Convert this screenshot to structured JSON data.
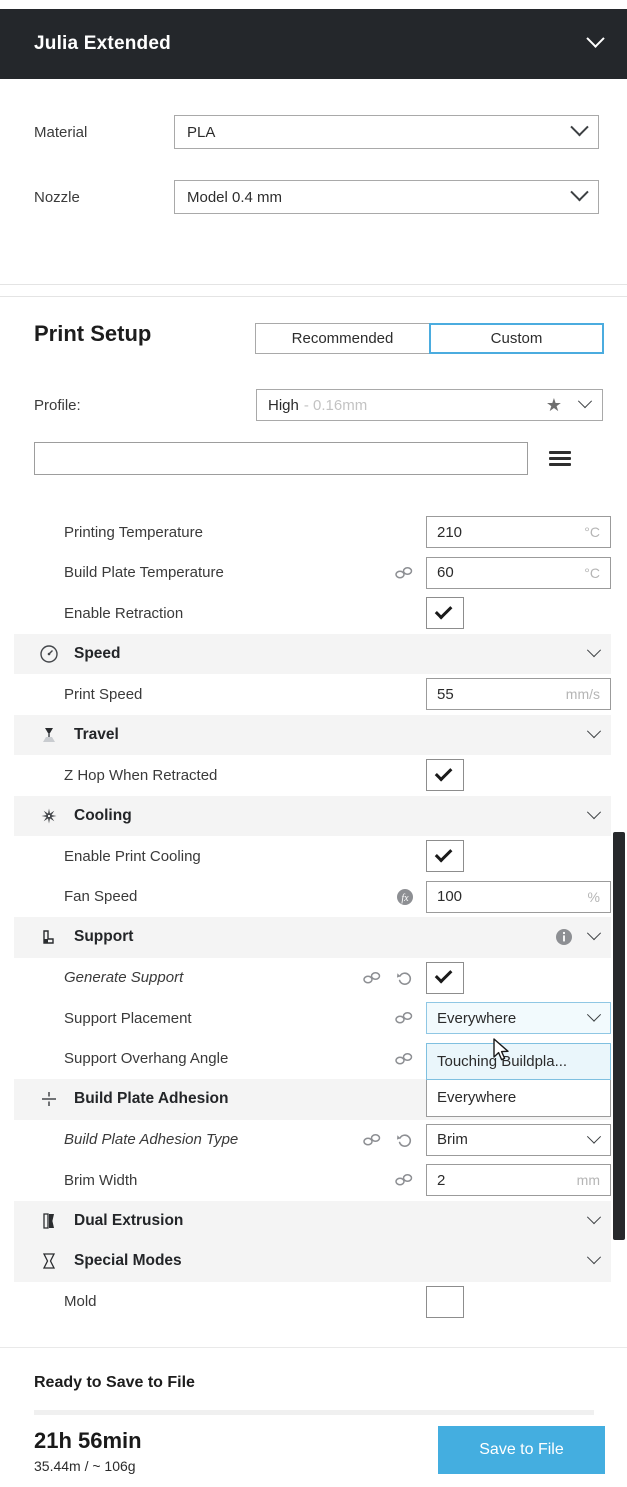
{
  "titlebar": {
    "title": "Julia Extended",
    "chevron_icon": "chevron-down-icon"
  },
  "machine": {
    "rows": [
      {
        "label": "Material",
        "value": "PLA"
      },
      {
        "label": "Nozzle",
        "value": "Model 0.4 mm"
      }
    ]
  },
  "print_setup": {
    "title": "Print Setup",
    "tabs": [
      {
        "label": "Recommended",
        "active": false
      },
      {
        "label": "Custom",
        "active": true
      }
    ],
    "profile": {
      "label": "Profile:",
      "value_main": "High",
      "value_sub": "- 0.16mm",
      "star_icon": "star-icon",
      "chevron_icon": "chevron-down-icon"
    },
    "search": {
      "value": "",
      "placeholder": ""
    },
    "menu_icon": "hamburger-menu-icon"
  },
  "settings": [
    {
      "type": "setting",
      "label": "Printing Temperature",
      "control": "number",
      "value": "210",
      "unit": "°C",
      "icons": []
    },
    {
      "type": "setting",
      "label": "Build Plate Temperature",
      "control": "number",
      "value": "60",
      "unit": "°C",
      "icons": [
        "link-icon"
      ]
    },
    {
      "type": "setting",
      "label": "Enable Retraction",
      "control": "checkbox",
      "checked": true,
      "icons": []
    },
    {
      "type": "category",
      "label": "Speed",
      "icon": "speedometer-icon",
      "info": false
    },
    {
      "type": "setting",
      "label": "Print Speed",
      "control": "number",
      "value": "55",
      "unit": "mm/s",
      "icons": []
    },
    {
      "type": "category",
      "label": "Travel",
      "icon": "nozzle-travel-icon",
      "info": false
    },
    {
      "type": "setting",
      "label": "Z Hop When Retracted",
      "control": "checkbox",
      "checked": true,
      "icons": []
    },
    {
      "type": "category",
      "label": "Cooling",
      "icon": "fan-icon",
      "info": false
    },
    {
      "type": "setting",
      "label": "Enable Print Cooling",
      "control": "checkbox",
      "checked": true,
      "icons": []
    },
    {
      "type": "setting",
      "label": "Fan Speed",
      "control": "number",
      "value": "100",
      "unit": "%",
      "icons": [
        "fx-icon"
      ]
    },
    {
      "type": "category",
      "label": "Support",
      "icon": "support-icon",
      "info": true
    },
    {
      "type": "setting",
      "label": "Generate Support",
      "control": "checkbox",
      "checked": true,
      "italic": true,
      "icons": [
        "link-icon",
        "revert-icon"
      ]
    },
    {
      "type": "setting",
      "label": "Support Placement",
      "control": "select",
      "value": "Everywhere",
      "open": true,
      "icons": [
        "link-icon"
      ]
    },
    {
      "type": "setting",
      "label": "Support Overhang Angle",
      "control": "hidden",
      "icons": [
        "link-icon"
      ]
    },
    {
      "type": "category",
      "label": "Build Plate Adhesion",
      "icon": "adhesion-icon",
      "info": false
    },
    {
      "type": "setting",
      "label": "Build Plate Adhesion Type",
      "control": "select",
      "value": "Brim",
      "italic": true,
      "icons": [
        "link-icon",
        "revert-icon"
      ]
    },
    {
      "type": "setting",
      "label": "Brim Width",
      "control": "number",
      "value": "2",
      "unit": "mm",
      "icons": [
        "link-icon"
      ]
    },
    {
      "type": "category",
      "label": "Dual Extrusion",
      "icon": "dual-extrusion-icon",
      "info": false
    },
    {
      "type": "category",
      "label": "Special Modes",
      "icon": "special-modes-icon",
      "info": false
    },
    {
      "type": "setting",
      "label": "Mold",
      "control": "checkbox",
      "checked": false,
      "icons": []
    }
  ],
  "dropdown": {
    "open": true,
    "items": [
      {
        "label": "Touching Buildpla...",
        "highlighted": true
      },
      {
        "label": "Everywhere",
        "highlighted": false
      }
    ]
  },
  "footer": {
    "status": "Ready to Save to File",
    "time": "21h 56min",
    "material_info": "35.44m / ~ 106g",
    "save_button": "Save to File",
    "accent_color": "#44aee0"
  }
}
